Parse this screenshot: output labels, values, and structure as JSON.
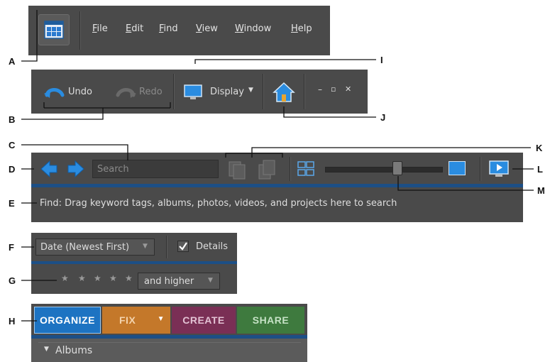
{
  "menubar": {
    "items": [
      "File",
      "Edit",
      "Find",
      "View",
      "Window",
      "Help"
    ]
  },
  "edit_toolbar": {
    "undo": "Undo",
    "redo": "Redo",
    "display": "Display",
    "window_controls": [
      "–",
      "▫",
      "✕"
    ]
  },
  "find_bar": {
    "search_placeholder": "Search",
    "find_text": "Find: Drag keyword tags, albums, photos, videos, and projects here to search"
  },
  "sort_bar": {
    "sort_value": "Date (Newest First)",
    "details_label": "Details",
    "details_checked": true
  },
  "rating_bar": {
    "stars": 5,
    "filter_value": "and higher"
  },
  "tabs": [
    {
      "label": "ORGANIZE",
      "color": "#1d73c2"
    },
    {
      "label": "FIX",
      "color": "#c4782a"
    },
    {
      "label": "CREATE",
      "color": "#7a2f55"
    },
    {
      "label": "SHARE",
      "color": "#3e7a3e"
    }
  ],
  "albums_label": "Albums",
  "callouts": [
    "A",
    "B",
    "C",
    "D",
    "E",
    "F",
    "G",
    "H",
    "I",
    "J",
    "K",
    "L",
    "M"
  ],
  "colors": {
    "panel": "#4a4a4a",
    "accent_blue": "#1c4f86",
    "arrow_blue": "#2a8ce0"
  }
}
